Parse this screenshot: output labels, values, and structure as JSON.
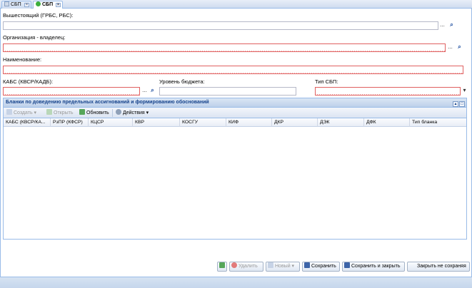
{
  "tabs": [
    {
      "label": "СБП",
      "close": "×"
    },
    {
      "label": "СБП",
      "close": "×"
    }
  ],
  "form": {
    "superior_label": "Вышестоящий (ГРБС, РБС):",
    "owner_label": "Организация - владелец:",
    "name_label": "Наименование:",
    "kbs_label": "КАБС (КВСР/КАДБ):",
    "budget_level_label": "Уровень бюджета:",
    "sbp_type_label": "Тип СБП:",
    "ellipsis": "...",
    "chevron": "▾"
  },
  "grid": {
    "title": "Бланки по доведению предельных ассигнований и формированию обоснований",
    "toolbar": {
      "create": "Создать",
      "open": "Открыть",
      "refresh": "Обновить",
      "actions": "Действия"
    },
    "columns": [
      "КАБС (КВСР/КА...",
      "РзПР (КФСР)",
      "КЦСР",
      "КВР",
      "КОСГУ",
      "КИФ",
      "ДКР",
      "ДЭК",
      "ДФК",
      "Тип бланка"
    ]
  },
  "buttons": {
    "delete": "Удалить",
    "new": "Новый",
    "save": "Сохранить",
    "save_close": "Сохранить и закрыть",
    "close_nosave": "Закрыть не сохраняя"
  }
}
